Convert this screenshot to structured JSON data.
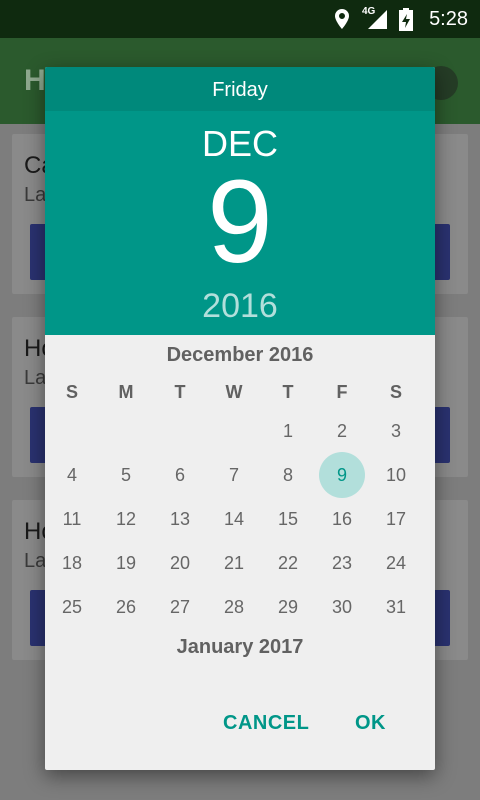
{
  "status_bar": {
    "time": "5:28",
    "network": "4G"
  },
  "app": {
    "title": "H",
    "cards": [
      {
        "t1": "Ca",
        "t2": "La"
      },
      {
        "t1": "Ho",
        "t2": "La"
      },
      {
        "t1": "Ho",
        "t2": "La"
      }
    ]
  },
  "dialog": {
    "weekday": "Friday",
    "month": "DEC",
    "date": "9",
    "year": "2016",
    "calendar_title": "December 2016",
    "weekday_headers": [
      "S",
      "M",
      "T",
      "W",
      "T",
      "F",
      "S"
    ],
    "days": [
      [
        "",
        "",
        "",
        "",
        "1",
        "2",
        "3"
      ],
      [
        "4",
        "5",
        "6",
        "7",
        "8",
        "9",
        "10"
      ],
      [
        "11",
        "12",
        "13",
        "14",
        "15",
        "16",
        "17"
      ],
      [
        "18",
        "19",
        "20",
        "21",
        "22",
        "23",
        "24"
      ],
      [
        "25",
        "26",
        "27",
        "28",
        "29",
        "30",
        "31"
      ]
    ],
    "selected_day": "9",
    "next_month_title": "January 2017",
    "cancel_label": "CANCEL",
    "ok_label": "OK"
  },
  "colors": {
    "accent": "#009688",
    "header_dark": "#00897b",
    "selection": "#b2dfdb"
  }
}
